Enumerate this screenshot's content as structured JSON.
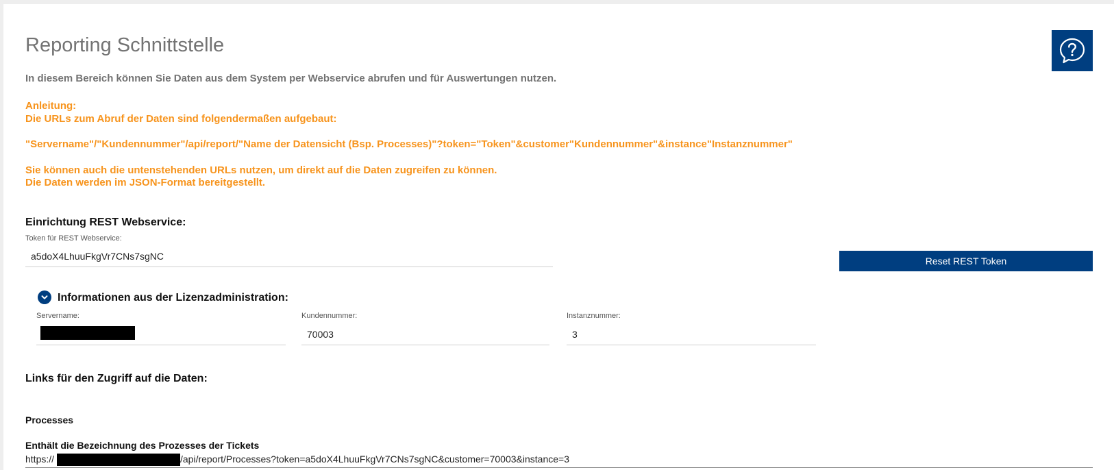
{
  "page": {
    "title": "Reporting Schnittstelle",
    "intro": "In diesem Bereich können Sie Daten aus dem System per Webservice abrufen und für Auswertungen nutzen.",
    "help_icon": "question-speech-bubble-icon",
    "accent_color": "#003e80",
    "instruction_color": "#f7941d"
  },
  "instructions": {
    "heading": "Anleitung:",
    "line1": "Die URLs zum Abruf der Daten sind folgendermaßen aufgebaut:",
    "url_pattern": "\"Servername\"/\"Kundennummer\"/api/report/\"Name der Datensicht (Bsp. Processes)\"?token=\"Token\"&customer\"Kundennummer\"&instance\"Instanznummer\"",
    "line2": "Sie können auch die untenstehenden URLs nutzen, um direkt auf die Daten zugreifen zu können.",
    "line3": "Die Daten werden im JSON-Format bereitgestellt."
  },
  "rest": {
    "heading": "Einrichtung REST Webservice:",
    "token_label": "Token für REST Webservice:",
    "token_value": "a5doX4LhuuFkgVr7CNs7sgNC",
    "reset_button": "Reset REST Token"
  },
  "license": {
    "heading": "Informationen aus der Lizenzadministration:",
    "toggle_icon": "chevron-down-icon",
    "servername_label": "Servername:",
    "servername_value": "",
    "customer_label": "Kundennummer:",
    "customer_value": "70003",
    "instance_label": "Instanznummer:",
    "instance_value": "3"
  },
  "links": {
    "heading": "Links für den Zugriff auf die Daten:",
    "items": [
      {
        "name": "Processes",
        "description": "Enthält die Bezeichnung des Prozesses der Tickets",
        "url_prefix": "https://",
        "url_suffix": "/api/report/Processes?token=a5doX4LhuuFkgVr7CNs7sgNC&customer=70003&instance=3"
      }
    ]
  }
}
